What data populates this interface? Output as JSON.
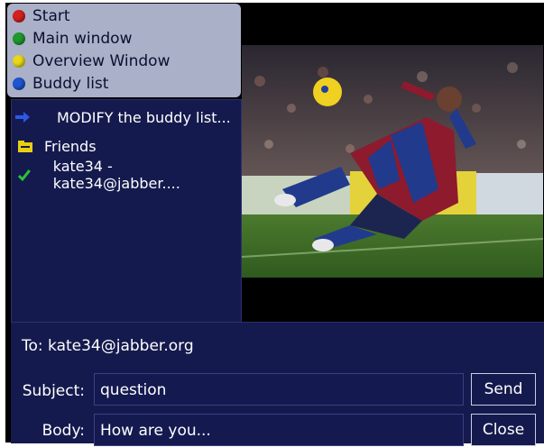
{
  "menu": {
    "items": [
      {
        "label": "Start",
        "color": "#d42020"
      },
      {
        "label": "Main window",
        "color": "#1f9a2a"
      },
      {
        "label": "Overview Window",
        "color": "#e8d818"
      },
      {
        "label": "Buddy list",
        "color": "#1f55d0"
      }
    ]
  },
  "buddy_list": {
    "modify_label": "MODIFY the buddy list...",
    "group_label": "Friends",
    "contact_label": "kate34 - kate34@jabber...."
  },
  "compose": {
    "to": "To: kate34@jabber.org",
    "subject_label": "Subject:",
    "subject_value": "question",
    "body_label": "Body:",
    "body_value": "How are you...",
    "send_label": "Send",
    "close_label": "Close"
  },
  "colors": {
    "panel": "#151a4e",
    "menu_bg": "#a9b0c8",
    "check": "#29c43a",
    "folder": "#e8d010",
    "arrow": "#2a5ae8"
  },
  "icons": [
    "arrow-right-icon",
    "folder-icon",
    "check-icon"
  ]
}
